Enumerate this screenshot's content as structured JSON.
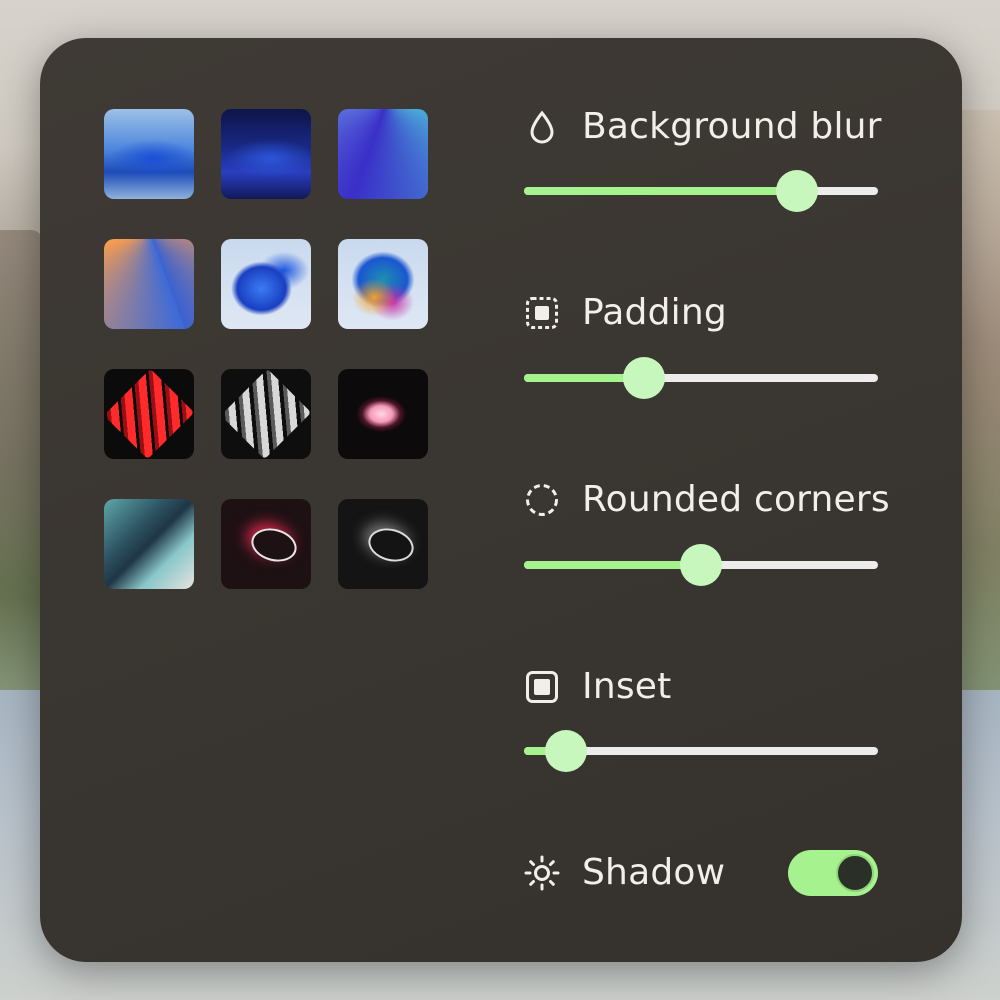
{
  "panel": {
    "wallpapers": [
      {
        "name": "blue-waves-light"
      },
      {
        "name": "blue-waves-dark"
      },
      {
        "name": "blue-green-rays"
      },
      {
        "name": "orange-blue-rays"
      },
      {
        "name": "blue-bloom"
      },
      {
        "name": "colorful-bloom"
      },
      {
        "name": "red-stripes"
      },
      {
        "name": "gray-stripes"
      },
      {
        "name": "pink-blob"
      },
      {
        "name": "teal-abstract"
      },
      {
        "name": "red-ring"
      },
      {
        "name": "white-ring"
      }
    ],
    "settings": {
      "background_blur": {
        "label": "Background blur",
        "icon": "drop-icon",
        "value": 0.77
      },
      "padding": {
        "label": "Padding",
        "icon": "padding-icon",
        "value": 0.34
      },
      "rounded_corners": {
        "label": "Rounded corners",
        "icon": "dashed-circle-icon",
        "value": 0.5
      },
      "inset": {
        "label": "Inset",
        "icon": "inset-square-icon",
        "value": 0.12
      },
      "shadow": {
        "label": "Shadow",
        "icon": "sun-icon",
        "enabled": true
      }
    },
    "accent_color": "#a6f28f"
  }
}
